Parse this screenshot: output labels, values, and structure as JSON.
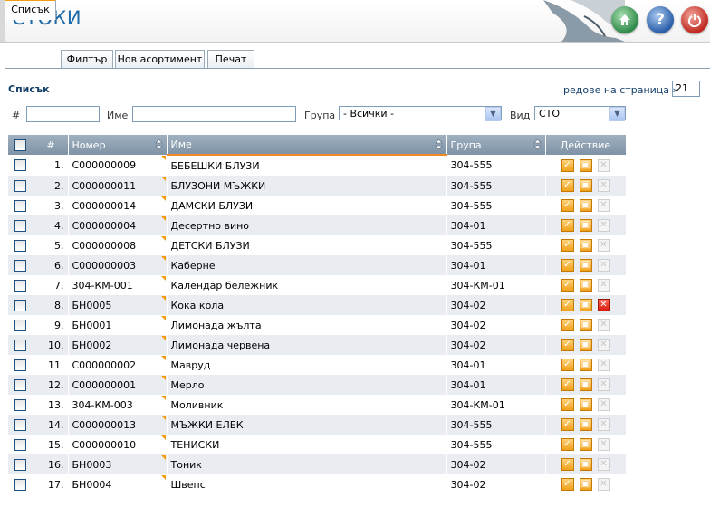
{
  "header": {
    "title": "СТОКИ"
  },
  "tabs": [
    {
      "label": "Списък",
      "active": true
    },
    {
      "label": "Филтър",
      "active": false
    },
    {
      "label": "Нов асортимент",
      "active": false
    },
    {
      "label": "Печат",
      "active": false
    }
  ],
  "section_title": "Списък",
  "rows_per_page": {
    "label": "редове на страница »",
    "value": "21"
  },
  "filters": {
    "num_label": "#",
    "name_label": "Име",
    "group_label": "Група",
    "group_value": "- Всички -",
    "type_label": "Вид",
    "type_value": "СТО"
  },
  "table": {
    "columns": [
      "#",
      "Номер",
      "Име",
      "Група",
      "Действие"
    ],
    "rows": [
      {
        "n": "1.",
        "code": "C000000009",
        "name": "БЕБЕШКИ БЛУЗИ",
        "group": "304-555",
        "deletable": false
      },
      {
        "n": "2.",
        "code": "C000000011",
        "name": "БЛУЗОНИ МЪЖКИ",
        "group": "304-555",
        "deletable": false
      },
      {
        "n": "3.",
        "code": "C000000014",
        "name": "ДАМСКИ БЛУЗИ",
        "group": "304-555",
        "deletable": false
      },
      {
        "n": "4.",
        "code": "C000000004",
        "name": "Десертно вино",
        "group": "304-01",
        "deletable": false
      },
      {
        "n": "5.",
        "code": "C000000008",
        "name": "ДЕТСКИ БЛУЗИ",
        "group": "304-555",
        "deletable": false
      },
      {
        "n": "6.",
        "code": "C000000003",
        "name": "Каберне",
        "group": "304-01",
        "deletable": false
      },
      {
        "n": "7.",
        "code": "304-КМ-001",
        "name": "Календар бележник",
        "group": "304-КМ-01",
        "deletable": false
      },
      {
        "n": "8.",
        "code": "БН0005",
        "name": "Кока кола",
        "group": "304-02",
        "deletable": true
      },
      {
        "n": "9.",
        "code": "БН0001",
        "name": "Лимонада жълта",
        "group": "304-02",
        "deletable": false
      },
      {
        "n": "10.",
        "code": "БН0002",
        "name": "Лимонада червена",
        "group": "304-02",
        "deletable": false
      },
      {
        "n": "11.",
        "code": "C000000002",
        "name": "Мавруд",
        "group": "304-01",
        "deletable": false
      },
      {
        "n": "12.",
        "code": "C000000001",
        "name": "Мерло",
        "group": "304-01",
        "deletable": false
      },
      {
        "n": "13.",
        "code": "304-КМ-003",
        "name": "Моливник",
        "group": "304-КМ-01",
        "deletable": false
      },
      {
        "n": "14.",
        "code": "C000000013",
        "name": "МЪЖКИ ЕЛЕК",
        "group": "304-555",
        "deletable": false
      },
      {
        "n": "15.",
        "code": "C000000010",
        "name": "ТЕНИСКИ",
        "group": "304-555",
        "deletable": false
      },
      {
        "n": "16.",
        "code": "БН0003",
        "name": "Тоник",
        "group": "304-02",
        "deletable": false
      },
      {
        "n": "17.",
        "code": "БН0004",
        "name": "Швепс",
        "group": "304-02",
        "deletable": false
      }
    ]
  },
  "icons": {
    "home": "home-icon",
    "help": "help-icon",
    "power": "power-icon",
    "edit": "checkbox-edit-icon",
    "copy": "copy-icon",
    "delete": "delete-icon"
  },
  "colors": {
    "title": "#1e6aa8",
    "header_row": "#8fa1b3",
    "accent": "#f39c12",
    "delete_active": "#d8190a"
  }
}
